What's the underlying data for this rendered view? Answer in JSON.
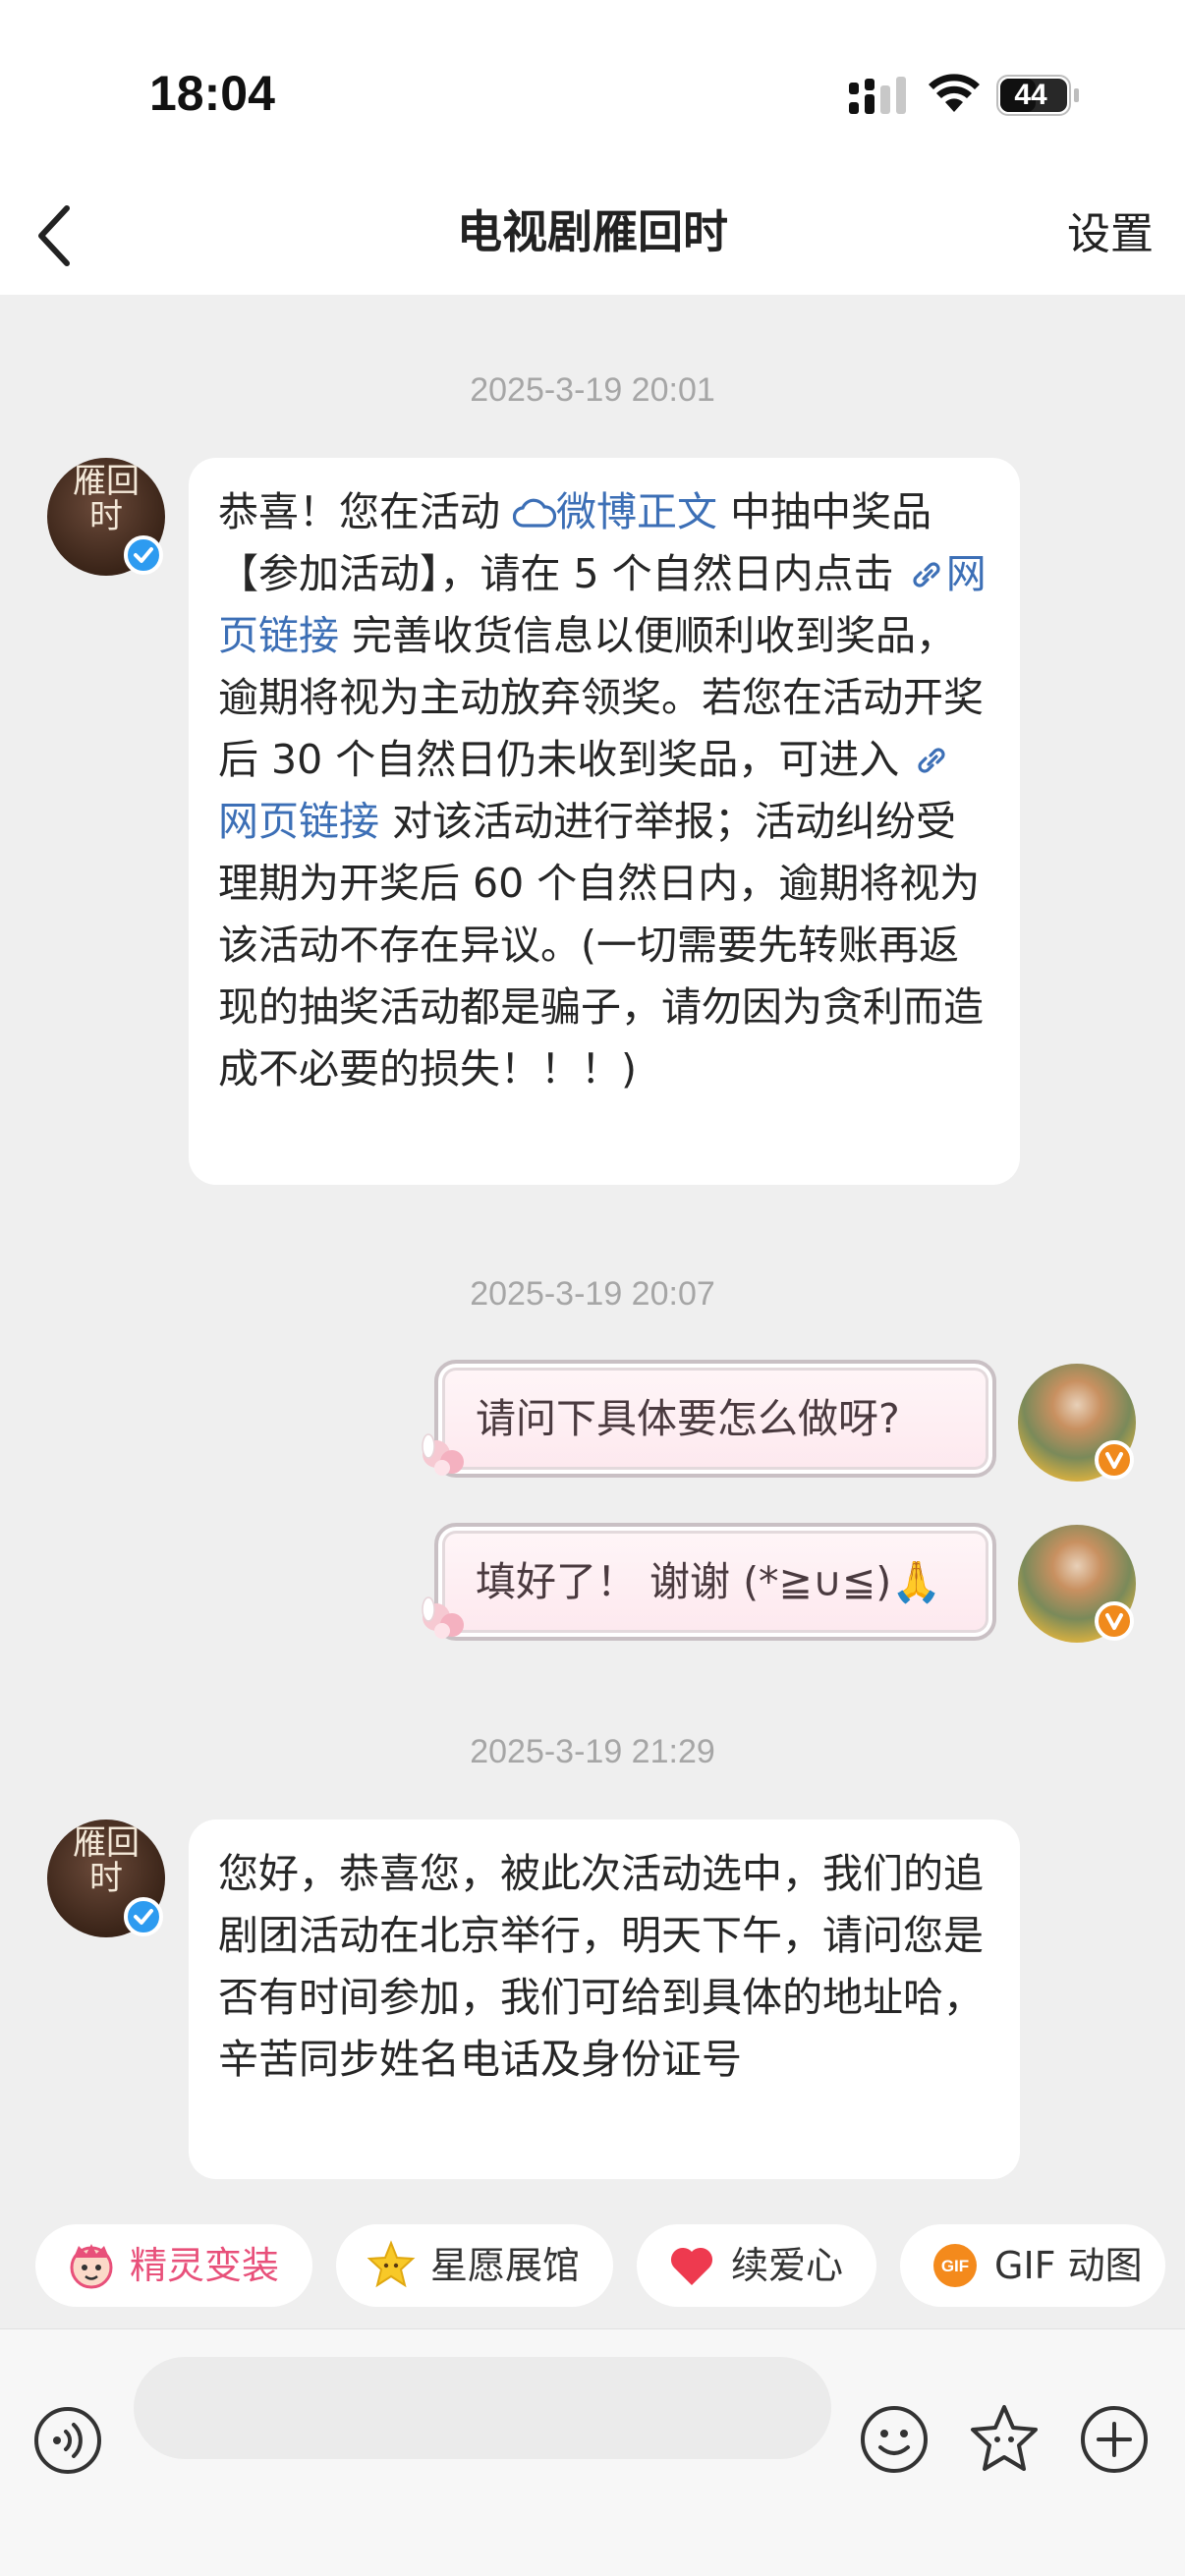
{
  "status_bar": {
    "time": "18:04",
    "battery": "44"
  },
  "nav": {
    "title": "电视剧雁回时",
    "settings_label": "设置"
  },
  "brand_avatar_text": "雁回时",
  "messages": [
    {
      "timestamp": "2025-3-19 20:01",
      "text_parts": [
        "恭喜！您在活动 ",
        "微博正文",
        " 中抽中奖品【参加活动】，请在 5 个自然日内点击 ",
        "网页链接",
        " 完善收货信息以便顺利收到奖品，逾期将视为主动放弃领奖。若您在活动开奖后 30 个自然日仍未收到奖品，可进入 ",
        "网页链接",
        " 对该活动进行举报；活动纠纷受理期为开奖后 60 个自然日内，逾期将视为该活动不存在异议。(一切需要先转账再返现的抽奖活动都是骗子，请勿因为贪利而造成不必要的损失！！！)"
      ]
    },
    {
      "timestamp": "2025-3-19 20:07",
      "outgoing": [
        "请问下具体要怎么做呀?",
        "填好了！ 谢谢 (*≧∪≦)🙏"
      ]
    },
    {
      "timestamp": "2025-3-19 21:29",
      "text": "您好，恭喜您，被此次活动选中，我们的追剧团活动在北京举行，明天下午，请问您是否有时间参加，我们可给到具体的地址哈，辛苦同步姓名电话及身份证号"
    }
  ],
  "quick_actions": [
    {
      "label": "精灵变装",
      "color": "#e8507a"
    },
    {
      "label": "星愿展馆",
      "color": "#333333"
    },
    {
      "label": "续爱心",
      "color": "#333333"
    },
    {
      "label": "GIF 动图",
      "color": "#333333"
    }
  ],
  "input": {
    "placeholder": ""
  },
  "colors": {
    "link": "#3c6fb6",
    "verified": "#2d9bf0",
    "user_badge": "#f08a1c"
  }
}
